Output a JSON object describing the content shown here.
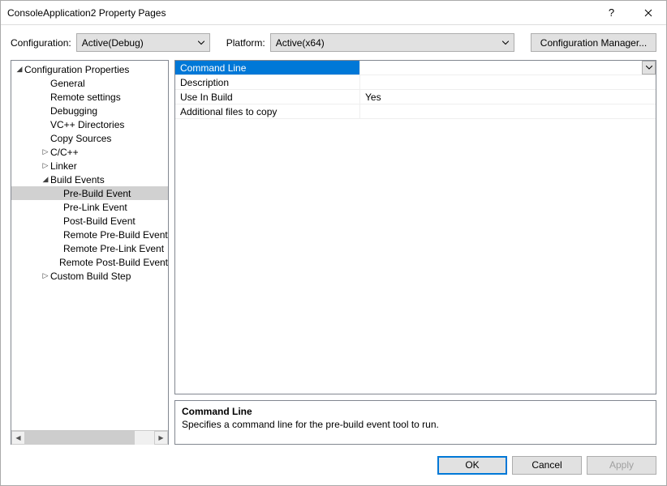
{
  "window": {
    "title": "ConsoleApplication2 Property Pages"
  },
  "configRow": {
    "configLabel": "Configuration:",
    "configValue": "Active(Debug)",
    "platformLabel": "Platform:",
    "platformValue": "Active(x64)",
    "managerBtn": "Configuration Manager..."
  },
  "tree": {
    "root": "Configuration Properties",
    "items": [
      {
        "label": "General",
        "indent": 2,
        "exp": ""
      },
      {
        "label": "Remote settings",
        "indent": 2,
        "exp": ""
      },
      {
        "label": "Debugging",
        "indent": 2,
        "exp": ""
      },
      {
        "label": "VC++ Directories",
        "indent": 2,
        "exp": ""
      },
      {
        "label": "Copy Sources",
        "indent": 2,
        "exp": ""
      },
      {
        "label": "C/C++",
        "indent": 2,
        "exp": "▷"
      },
      {
        "label": "Linker",
        "indent": 2,
        "exp": "▷"
      },
      {
        "label": "Build Events",
        "indent": 2,
        "exp": "◢"
      },
      {
        "label": "Pre-Build Event",
        "indent": 3,
        "exp": "",
        "selected": true
      },
      {
        "label": "Pre-Link Event",
        "indent": 3,
        "exp": ""
      },
      {
        "label": "Post-Build Event",
        "indent": 3,
        "exp": ""
      },
      {
        "label": "Remote Pre-Build Event",
        "indent": 3,
        "exp": ""
      },
      {
        "label": "Remote Pre-Link Event",
        "indent": 3,
        "exp": ""
      },
      {
        "label": "Remote Post-Build Event",
        "indent": 3,
        "exp": ""
      },
      {
        "label": "Custom Build Step",
        "indent": 2,
        "exp": "▷"
      }
    ]
  },
  "grid": {
    "rows": [
      {
        "label": "Command Line",
        "value": "",
        "selected": true,
        "dropdown": true
      },
      {
        "label": "Description",
        "value": ""
      },
      {
        "label": "Use In Build",
        "value": "Yes"
      },
      {
        "label": "Additional files to copy",
        "value": ""
      }
    ]
  },
  "desc": {
    "title": "Command Line",
    "text": "Specifies a command line for the pre-build event tool to run."
  },
  "footer": {
    "ok": "OK",
    "cancel": "Cancel",
    "apply": "Apply"
  }
}
